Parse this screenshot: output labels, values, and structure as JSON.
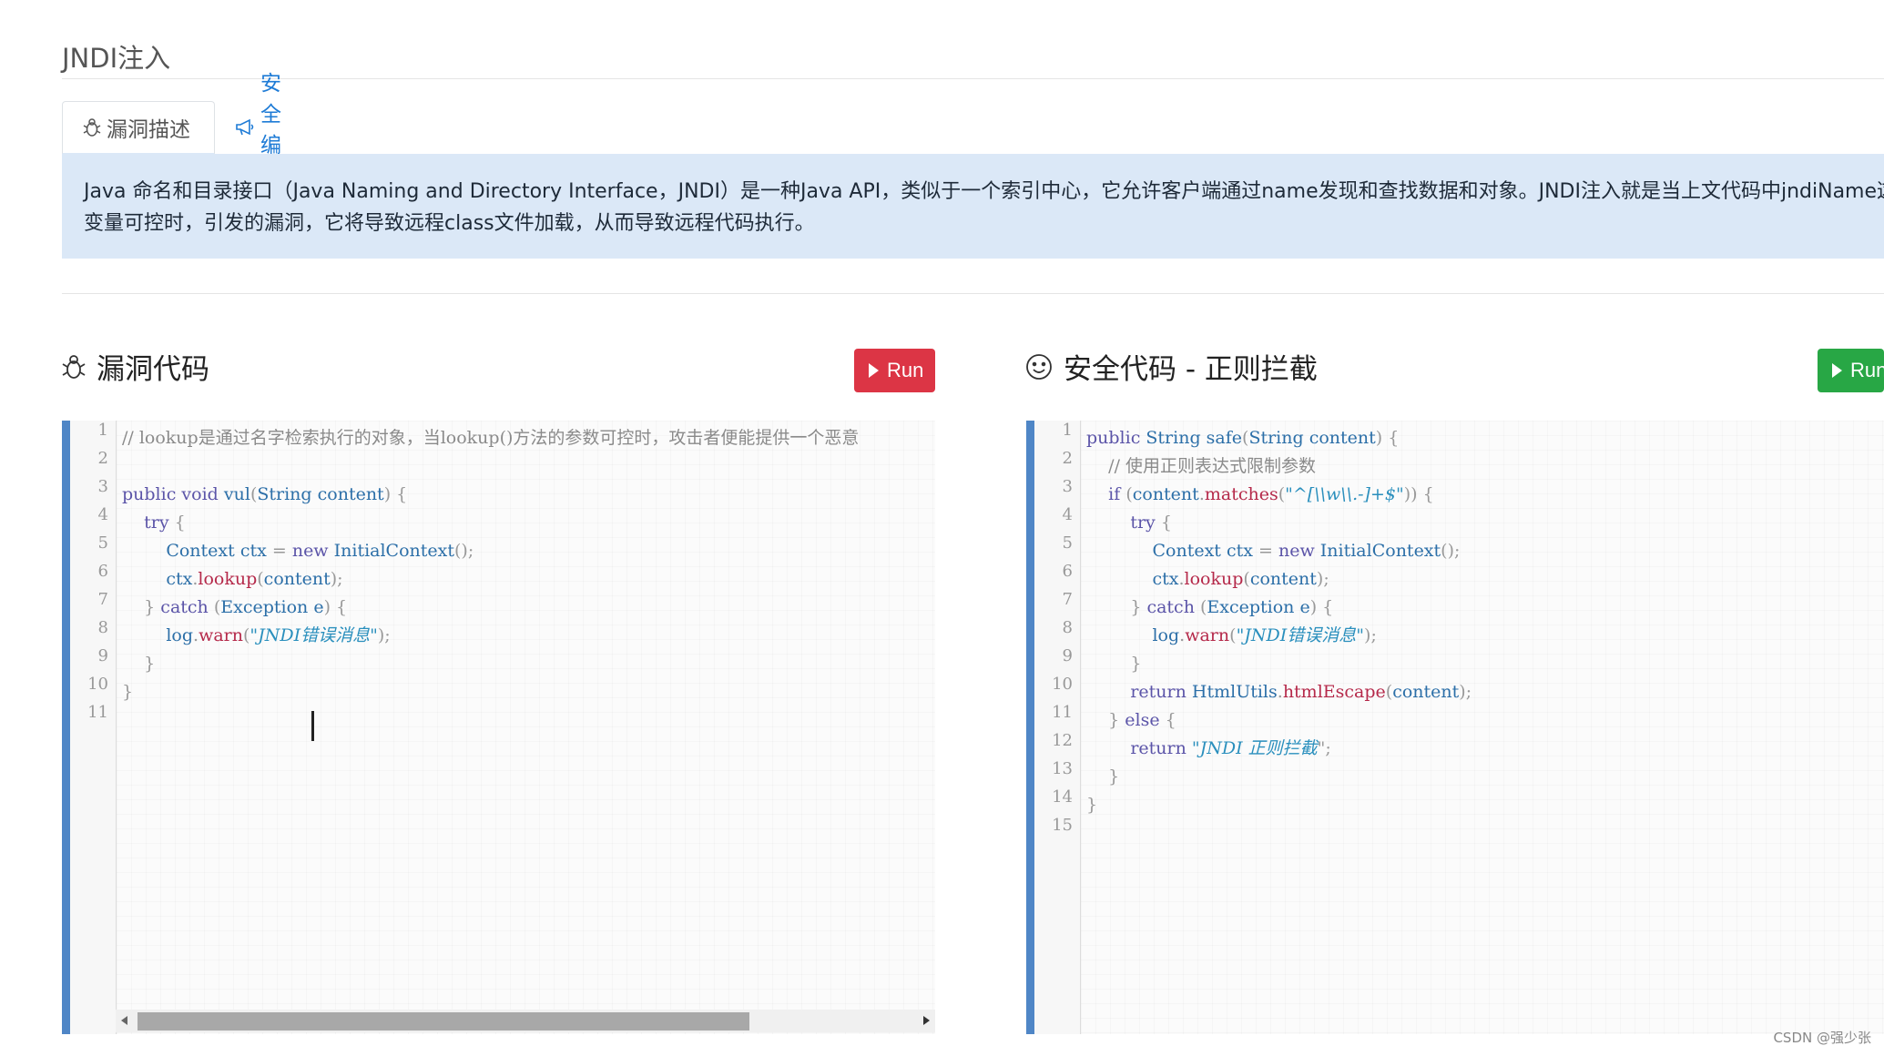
{
  "page": {
    "title": "JNDI注入"
  },
  "tabs": [
    {
      "label": "漏洞描述",
      "icon": "bug-icon",
      "active": true
    },
    {
      "label": "安全编码",
      "icon": "megaphone-icon",
      "active": false
    }
  ],
  "description": {
    "line1": "Java 命名和目录接口（Java Naming and Directory Interface，JNDI）是一种Java API，类似于一个索引中心，它允许客户端通过name发现和查找数据和对象。JNDI注入就是当上文代码中jndiName这个",
    "line2": "变量可控时，引发的漏洞，它将导致远程class文件加载，从而导致远程代码执行。"
  },
  "vulnerable": {
    "title": "漏洞代码",
    "icon": "bug-icon",
    "run_label": "Run",
    "line_numbers": [
      "1",
      "2",
      "3",
      "4",
      "5",
      "6",
      "7",
      "8",
      "9",
      "10",
      "11"
    ],
    "code": [
      "// lookup是通过名字检索执行的对象，当lookup()方法的参数可控时，攻击者便能提供一个恶意",
      "",
      "public void vul(String content) {",
      "    try {",
      "        Context ctx = new InitialContext();",
      "        ctx.lookup(content);",
      "    } catch (Exception e) {",
      "        log.warn(\"JNDI错误消息\");",
      "    }",
      "}",
      ""
    ]
  },
  "safe": {
    "title": "安全代码 - 正则拦截",
    "icon": "smiley-icon",
    "run_label": "Run",
    "line_numbers": [
      "1",
      "2",
      "3",
      "4",
      "5",
      "6",
      "7",
      "8",
      "9",
      "10",
      "11",
      "12",
      "13",
      "14",
      "15"
    ],
    "code": [
      "public String safe(String content) {",
      "    // 使用正则表达式限制参数",
      "    if (content.matches(\"^[\\\\w\\\\.-]+$\")) {",
      "        try {",
      "            Context ctx = new InitialContext();",
      "            ctx.lookup(content);",
      "        } catch (Exception e) {",
      "            log.warn(\"JNDI错误消息\");",
      "        }",
      "        return HtmlUtils.htmlEscape(content);",
      "    } else {",
      "        return \"JNDI 正则拦截\";",
      "    }",
      "}",
      ""
    ]
  },
  "watermark": "CSDN @强少张",
  "colors": {
    "accent_blue": "#4f86c6",
    "alert_bg": "#dbe8f7",
    "run_red": "#dc3545",
    "run_green": "#28a745",
    "link_blue": "#1e7bd6"
  }
}
